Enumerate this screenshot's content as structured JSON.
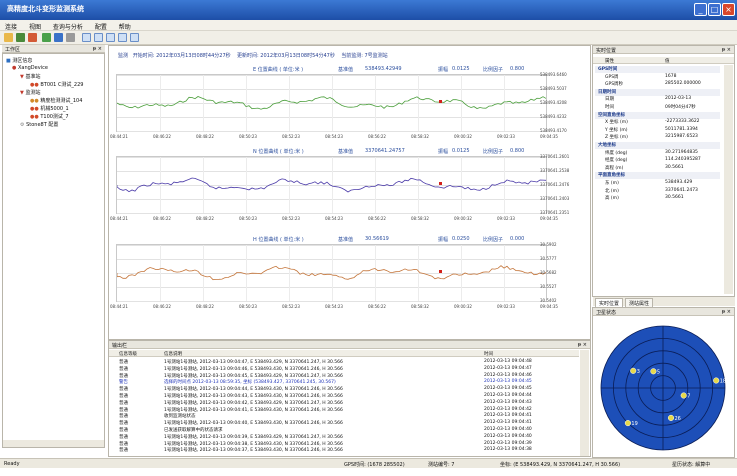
{
  "window": {
    "title": "高精度北斗变形监测系统"
  },
  "menu": [
    "连接",
    "视图",
    "查询与分析",
    "配置",
    "帮助"
  ],
  "panels": {
    "tree_title": "工作区",
    "output_title": "输出栏",
    "realtime_title": "实时位置",
    "sat_title": "卫星状态"
  },
  "tree": [
    "测区信息",
    "XangDevice",
    "基准站",
    "BT001 C测试_229",
    "监测站",
    "精度检测测试_104",
    "机械5000_1",
    "T100测试_7",
    "Stone8T 配置"
  ],
  "info": {
    "monitor": "监测",
    "start_label": "开始时间",
    "start": "2012年03月13日08时44分27秒",
    "update_label": "更新时间",
    "update": "2012年03月13日08时54分47秒",
    "station_label": "当前监测",
    "station": "7号监测站"
  },
  "charts": [
    {
      "title": "E 位置曲线 ( 单位:米 )",
      "base_label": "基准值",
      "base": "538493.42949",
      "amp_label": "振幅",
      "amp": "0.0125",
      "scale_label": "比例因子",
      "scale": "0.800",
      "yticks": [
        "538493.6460",
        "538493.5037",
        "538493.4208",
        "538493.4232",
        "538493.4170"
      ]
    },
    {
      "title": "N 位置曲线 ( 单位:米 )",
      "base_label": "基准值",
      "base": "3370641.24757",
      "amp_label": "振幅",
      "amp": "0.0125",
      "scale_label": "比例因子",
      "scale": "0.800",
      "yticks": [
        "3370641.2601",
        "3370641.2538",
        "3370641.2476",
        "3370641.2403",
        "3370641.2351"
      ]
    },
    {
      "title": "H 位置曲线 ( 单位:米 )",
      "base_label": "基准值",
      "base": "30.56619",
      "amp_label": "振幅",
      "amp": "0.0250",
      "scale_label": "比例因子",
      "scale": "0.000",
      "yticks": [
        "30.5902",
        "30.5777",
        "30.5682",
        "30.5527",
        "30.5402"
      ]
    }
  ],
  "xticks": [
    "08:44:21",
    "08:46:22",
    "08:48:22",
    "08:50:23",
    "08:52:23",
    "08:54:23",
    "08:56:22",
    "08:58:32",
    "09:00:32",
    "09:02:33",
    "09:04:35"
  ],
  "output": {
    "headers": [
      "信息等级",
      "信息说明",
      "时间"
    ],
    "rows": [
      {
        "level": "普通",
        "msg": "1号测站1号测站, 2012-03-13 09:04:47, E 538493.429, N 3370641.247, H 30.566",
        "time": "2012-03-13  09:04:48",
        "blue": false
      },
      {
        "level": "普通",
        "msg": "1号测站1号测站, 2012-03-13 09:04:46, E 538493.430, N 3370641.246, H 30.566",
        "time": "2012-03-13  09:04:47",
        "blue": false
      },
      {
        "level": "普通",
        "msg": "1号测站1号测站, 2012-03-13 09:04:45, E 538493.429, N 3370641.247, H 30.566",
        "time": "2012-03-13  09:04:46",
        "blue": false
      },
      {
        "level": "警告",
        "msg": "选择的时间点 2012-03-13 08:59:35, 坐标 (538493.427, 3370641.245, 30.567)",
        "time": "2012-03-13  09:04:45",
        "blue": true
      },
      {
        "level": "普通",
        "msg": "1号测站1号测站, 2012-03-13 09:04:44, E 538493.430, N 3370641.246, H 30.566",
        "time": "2012-03-13  09:04:45",
        "blue": false
      },
      {
        "level": "普通",
        "msg": "1号测站1号测站, 2012-03-13 09:04:43, E 538493.430, N 3370641.246, H 30.566",
        "time": "2012-03-13  09:04:44",
        "blue": false
      },
      {
        "level": "普通",
        "msg": "1号测站1号测站, 2012-03-13 09:04:42, E 538493.429, N 3370641.247, H 30.566",
        "time": "2012-03-13  09:04:43",
        "blue": false
      },
      {
        "level": "普通",
        "msg": "1号测站1号测站, 2012-03-13 09:04:41, E 538493.430, N 3370641.246, H 30.566",
        "time": "2012-03-13  09:04:42",
        "blue": false
      },
      {
        "level": "普通",
        "msg": "收到监测站状态",
        "time": "2012-03-13  09:04:41",
        "blue": false
      },
      {
        "level": "普通",
        "msg": "1号测站1号测站, 2012-03-13 09:04:40, E 538493.430, N 3370641.246, H 30.566",
        "time": "2012-03-13  09:04:41",
        "blue": false
      },
      {
        "level": "普通",
        "msg": "已发送获取解算中的状态请求",
        "time": "2012-03-13  09:04:40",
        "blue": false
      },
      {
        "level": "普通",
        "msg": "1号测站1号测站, 2012-03-13 09:04:39, E 538493.429, N 3370641.247, H 30.566",
        "time": "2012-03-13  09:04:40",
        "blue": false
      },
      {
        "level": "普通",
        "msg": "1号测站1号测站, 2012-03-13 09:04:38, E 538493.430, N 3370641.246, H 30.566",
        "time": "2012-03-13  09:04:39",
        "blue": false
      },
      {
        "level": "普通",
        "msg": "1号测站1号测站, 2012-03-13 09:04:37, E 538493.430, N 3370641.246, H 30.566",
        "time": "2012-03-13  09:04:38",
        "blue": false
      }
    ]
  },
  "props": {
    "headers": [
      "属性",
      "值"
    ],
    "rows": [
      {
        "k": "GPS时间",
        "v": "",
        "group": true
      },
      {
        "k": "GPS周",
        "v": "1678",
        "group": false
      },
      {
        "k": "GPS周秒",
        "v": "285502.000000",
        "group": false
      },
      {
        "k": "日期时间",
        "v": "",
        "group": true
      },
      {
        "k": "日期",
        "v": "2012-03-13",
        "group": false
      },
      {
        "k": "时间",
        "v": "09时04分47秒",
        "group": false
      },
      {
        "k": "空间直角坐标",
        "v": "",
        "group": true
      },
      {
        "k": "X 坐标 (m)",
        "v": "-2273333.3622",
        "group": false
      },
      {
        "k": "Y 坐标 (m)",
        "v": "5011781.3394",
        "group": false
      },
      {
        "k": "Z 坐标 (m)",
        "v": "3215987.6523",
        "group": false
      },
      {
        "k": "大地坐标",
        "v": "",
        "group": true
      },
      {
        "k": "纬度 (deg)",
        "v": "30.271964835",
        "group": false
      },
      {
        "k": "经度 (deg)",
        "v": "114.240395287",
        "group": false
      },
      {
        "k": "高程 (m)",
        "v": "30.5661",
        "group": false
      },
      {
        "k": "平面直角坐标",
        "v": "",
        "group": true
      },
      {
        "k": "东 (m)",
        "v": "538493.429",
        "group": false
      },
      {
        "k": "北 (m)",
        "v": "3370641.2473",
        "group": false
      },
      {
        "k": "高 (m)",
        "v": "30.5661",
        "group": false
      }
    ]
  },
  "tabs": [
    "实时位置",
    "测站属性"
  ],
  "satellites": [
    {
      "id": "3",
      "az": 300,
      "el": 40
    },
    {
      "id": "18",
      "az": 82,
      "el": 12
    },
    {
      "id": "7",
      "az": 110,
      "el": 58
    },
    {
      "id": "26",
      "az": 165,
      "el": 45
    },
    {
      "id": "19",
      "az": 225,
      "el": 18
    },
    {
      "id": "5",
      "az": 330,
      "el": 62
    }
  ],
  "status": {
    "ready": "Ready",
    "gps": "GPS时间: (1678 285502)",
    "station": "测站编号: 7",
    "coord": "坐标: (E 538493.429, N 3370641.247, H 30.566)",
    "sat": "星历状态: 解算中"
  }
}
